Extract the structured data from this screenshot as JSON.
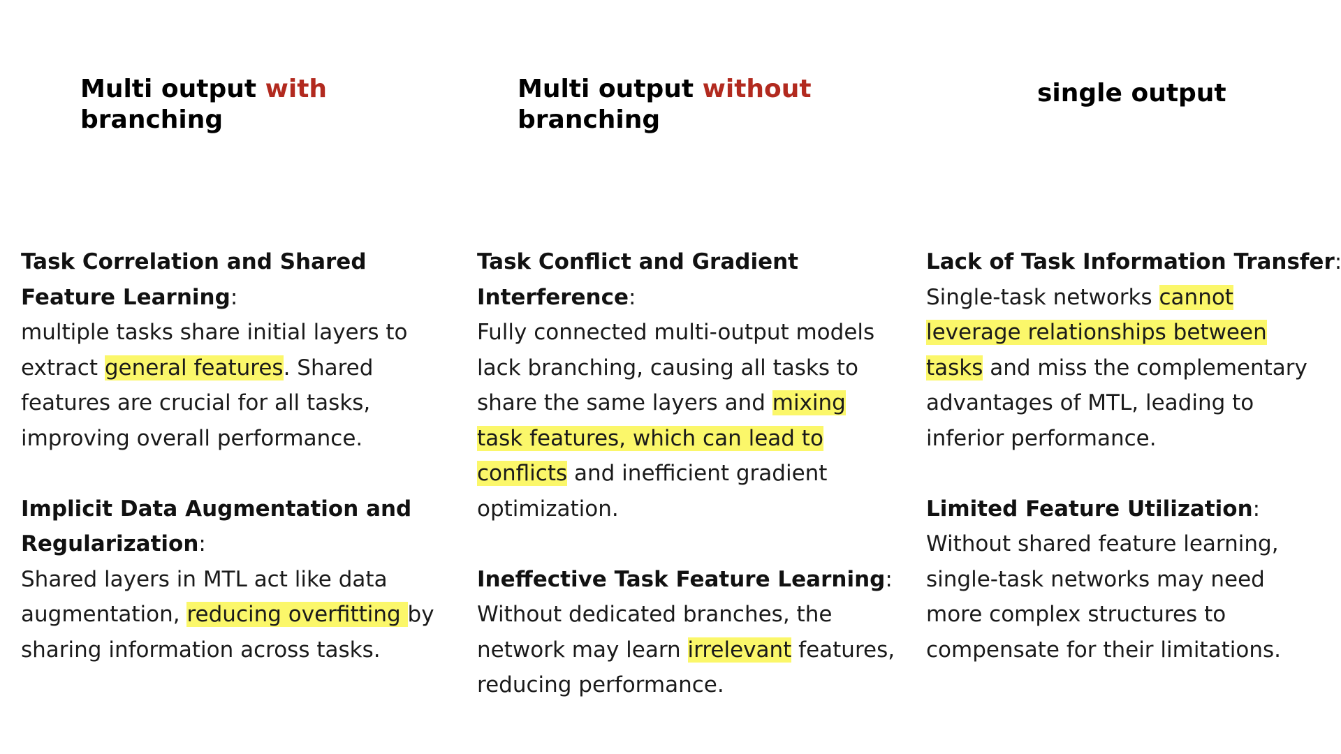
{
  "columns": [
    {
      "heading": {
        "pre": "Multi output ",
        "accent": "with",
        "post": "branching"
      },
      "blocks": [
        {
          "title": "Task Correlation and Shared Feature Learning",
          "colon": ":",
          "parts": [
            {
              "text": "multiple tasks share initial layers to extract "
            },
            {
              "text": "general features",
              "hl": true
            },
            {
              "text": ". Shared features are crucial for all tasks, improving overall performance."
            }
          ]
        },
        {
          "title": "Implicit Data Augmentation and Regularization",
          "colon": ":",
          "parts": [
            {
              "text": "Shared layers in MTL act like data augmentation, "
            },
            {
              "text": "reducing overfitting ",
              "hl": true
            },
            {
              "text": "by sharing information across tasks."
            }
          ]
        }
      ]
    },
    {
      "heading": {
        "pre": "Multi output ",
        "accent": "without",
        "post": "branching"
      },
      "blocks": [
        {
          "title": "Task Conflict and Gradient Interference",
          "colon": ":",
          "parts": [
            {
              "text": "Fully connected multi-output models lack branching, causing all tasks to share the same layers and "
            },
            {
              "text": "mixing task features, which can lead to conflicts",
              "hl": true
            },
            {
              "text": " and inefficient gradient optimization."
            }
          ]
        },
        {
          "title": "Ineffective Task Feature Learning",
          "colon": ":",
          "parts": [
            {
              "text": "Without dedicated branches, the network may learn "
            },
            {
              "text": "irrelevant",
              "hl": true
            },
            {
              "text": " features, reducing performance."
            }
          ]
        }
      ]
    },
    {
      "heading": {
        "pre": "single output",
        "accent": "",
        "post": ""
      },
      "blocks": [
        {
          "title": "Lack of Task Information Transfer",
          "colon": ":",
          "parts": [
            {
              "text": "Single-task networks "
            },
            {
              "text": "cannot leverage relationships between tasks",
              "hl": true
            },
            {
              "text": " and miss the complementary advantages of MTL, leading to inferior performance."
            }
          ]
        },
        {
          "title": "Limited Feature Utilization",
          "colon": ":",
          "parts": [
            {
              "text": "Without shared feature learning, single-task networks may need more complex structures to compensate for their limitations."
            }
          ]
        }
      ]
    }
  ],
  "colors": {
    "accent": "#b22a1f",
    "highlight": "#fbf76a",
    "text": "#1a1a1a"
  }
}
